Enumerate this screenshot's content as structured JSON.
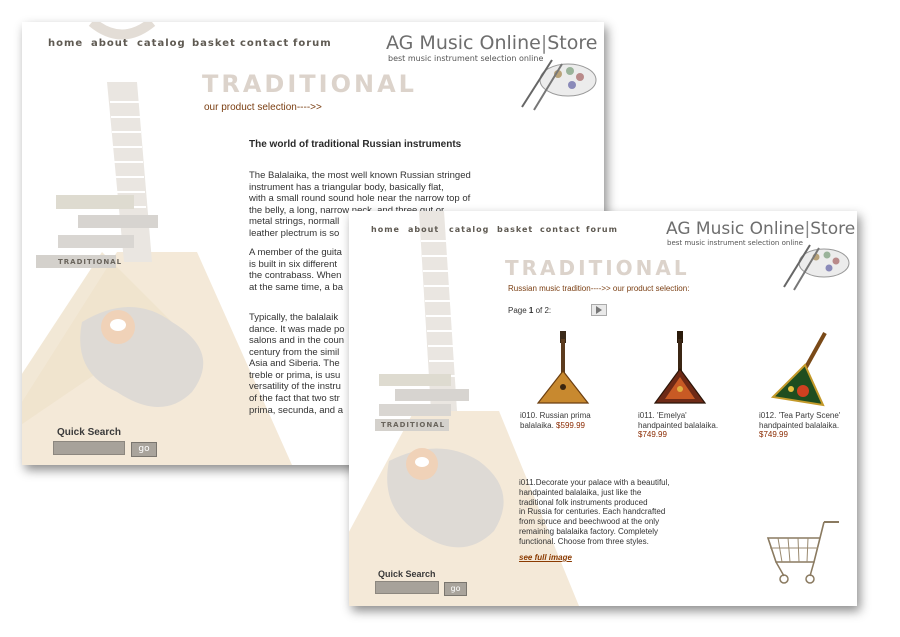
{
  "nav": [
    "home",
    "about",
    "catalog",
    "basket",
    "contact",
    "forum"
  ],
  "logo": {
    "name_part1": "AG Music Online",
    "name_part2": "Store",
    "tagline": "best music instrument selection online"
  },
  "section_title": "TRADITIONAL",
  "side_label": "TRADITIONAL",
  "quick_search": {
    "label": "Quick Search",
    "button": "go"
  },
  "page_back": {
    "link": "our product selection---->>",
    "article_heading": "The world of traditional Russian instruments",
    "paragraphs": [
      [
        "The Balalaika, the most well known Russian stringed",
        "instrument has a triangular body, basically flat,",
        "with a small round sound hole near the narrow top of",
        "the belly, a long, narrow neck, and three gut or",
        "metal strings, normall",
        "leather plectrum is so"
      ],
      [
        "A member of the guita",
        "is built in six different",
        "the contrabass. When",
        "at the same time, a ba"
      ],
      [
        "Typically, the balalaik",
        "dance. It was made po",
        "salons and in the coun",
        "century from the simil",
        "Asia and Siberia. The",
        "treble or prima, is usu",
        "versatility of the instru",
        "of the fact that two str",
        "prima, secunda, and a"
      ]
    ]
  },
  "page_front": {
    "breadcrumb": "Russian music tradition---->> our product selection:",
    "pagination": {
      "prefix": "Page ",
      "current": "1",
      "suffix": " of 2:"
    },
    "products": [
      {
        "code_name": "i010. Russian prima balalaika.",
        "price": "$599.99"
      },
      {
        "code_name": "i011. 'Emelya' handpainted balalaika.",
        "price": "$749.99"
      },
      {
        "code_name": "i012. 'Tea Party Scene' handpainted balalaika.",
        "price": "$749.99"
      }
    ],
    "description": [
      "i011.Decorate your palace with a beautiful,",
      "handpainted balalaika, just like the",
      "traditional folk instruments produced",
      "in Russia for centuries. Each handcrafted",
      "from spruce and beechwood at the only",
      "remaining balalaika factory. Completely",
      "functional. Choose from three styles."
    ],
    "full_image_link": "see full image"
  },
  "colors": {
    "accent_brown": "#7a3e12",
    "price_red": "#8a2a00",
    "title_faded": "#dcd3cb"
  },
  "icons": [
    "balalaika-background",
    "palette-brush-logo-icon",
    "next-page-arrow-icon",
    "shopping-cart-icon"
  ]
}
